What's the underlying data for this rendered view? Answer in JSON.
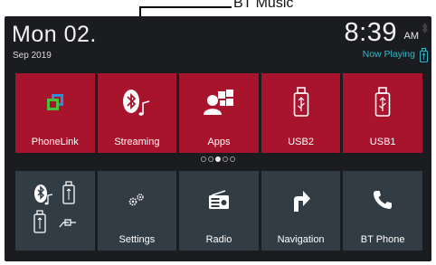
{
  "callout": {
    "label": "BT Music"
  },
  "header": {
    "date_big": "Mon 02.",
    "date_small": "Sep 2019",
    "time": "8:39",
    "ampm": "AM",
    "now_playing": "Now Playing"
  },
  "top_row": [
    {
      "label": "PhoneLink",
      "icon": "phonelink-icon"
    },
    {
      "label": "Streaming",
      "icon": "bluetooth-music-icon"
    },
    {
      "label": "Apps",
      "icon": "apps-icon"
    },
    {
      "label": "USB2",
      "icon": "usb-icon"
    },
    {
      "label": "USB1",
      "icon": "usb-icon"
    }
  ],
  "pager": {
    "count": 5,
    "active_index": 2
  },
  "bottom_row": [
    {
      "label": "",
      "icon": "media-sources-icon"
    },
    {
      "label": "Settings",
      "icon": "gears-icon"
    },
    {
      "label": "Radio",
      "icon": "radio-icon"
    },
    {
      "label": "Navigation",
      "icon": "navigation-arrow-icon"
    },
    {
      "label": "BT Phone",
      "icon": "phone-icon"
    }
  ],
  "colors": {
    "top_tile": "#a8142c",
    "bottom_tile": "#323c45",
    "background": "#1b1c1f",
    "now_playing": "#33b5c8",
    "phonelink_green": "#46c23e",
    "phonelink_blue": "#2f8cd8"
  }
}
